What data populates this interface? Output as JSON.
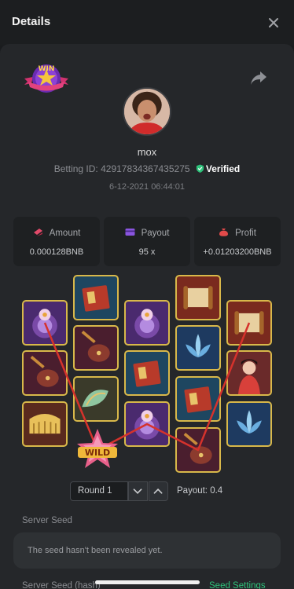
{
  "header": {
    "title": "Details"
  },
  "profile": {
    "username": "mox",
    "betting_id_label": "Betting ID:",
    "betting_id": "42917834367435275",
    "verified_label": "Verified",
    "timestamp": "6-12-2021 06:44:01",
    "badge_text": "WIN"
  },
  "stats": [
    {
      "label": "Amount",
      "value": "0.000128BNB",
      "icon": "coin-pile-icon"
    },
    {
      "label": "Payout",
      "value": "95 x",
      "icon": "card-icon"
    },
    {
      "label": "Profit",
      "value": "+0.01203200BNB",
      "icon": "money-bag-icon"
    }
  ],
  "game": {
    "round_label": "Round 1",
    "payout_label": "Payout: 0.4",
    "wild_text": "WILD"
  },
  "seed": {
    "server_seed_label": "Server Seed",
    "server_seed_text": "The seed hasn't been revealed yet.",
    "server_seed_hash_label": "Server Seed (hash)",
    "seed_settings_label": "Seed Settings"
  },
  "colors": {
    "accent_green": "#2ec37b",
    "tile_border": "#d8b84a",
    "win_line": "#d5322c"
  }
}
